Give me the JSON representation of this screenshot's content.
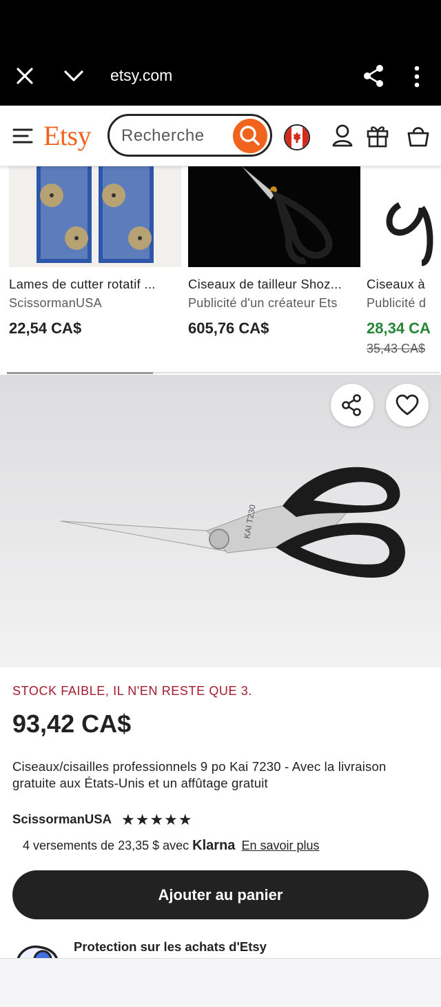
{
  "browser": {
    "url": "etsy.com",
    "icons": [
      "close-icon",
      "chevron-down-icon",
      "share-icon",
      "more-vert-icon"
    ]
  },
  "header": {
    "logo": "Etsy",
    "search_placeholder": "Recherche",
    "icons": [
      "menu-icon",
      "search-icon",
      "canada-flag-icon",
      "account-icon",
      "gift-icon",
      "cart-icon"
    ]
  },
  "recommendations": [
    {
      "title": "Lames de cutter rotatif ...",
      "seller": "ScissormanUSA",
      "price": "22,54 CA$"
    },
    {
      "title": "Ciseaux de tailleur Shoz...",
      "seller": "Publicité d'un créateur Ets",
      "price": "605,76 CA$"
    },
    {
      "title": "Ciseaux à",
      "seller": "Publicité d",
      "price": "28,34 CA",
      "original_price": "35,43 CA$"
    }
  ],
  "product": {
    "stock": "STOCK FAIBLE, IL N'EN RESTE QUE 3.",
    "price": "93,42 CA$",
    "title": "Ciseaux/cisailles professionnels 9 po Kai 7230 - Avec la livraison gratuite aux États-Unis et un affûtage gratuit",
    "shop": "ScissormanUSA",
    "stars": "★★★★★",
    "rating": 5,
    "klarna_text": "4 versements de 23,35 $ avec",
    "klarna_brand": "Klarna",
    "klarna_link": "En savoir plus",
    "add_to_cart": "Ajouter au panier",
    "protection": "Protection sur les achats d'Etsy"
  },
  "colors": {
    "brand": "#f1641e",
    "stock": "#a61a2e",
    "sale": "#258635"
  }
}
